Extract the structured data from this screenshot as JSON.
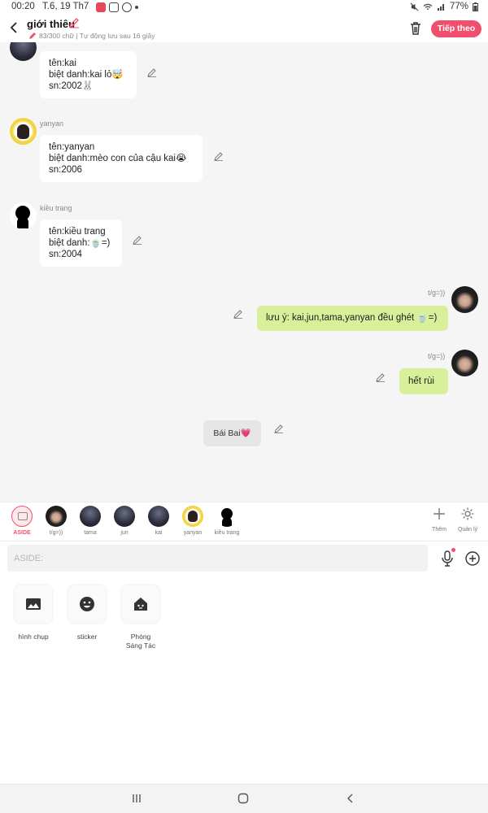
{
  "status_bar": {
    "time": "00:20",
    "date": "T.6, 19 Th7",
    "battery": "77%"
  },
  "header": {
    "title": "giới thiêu",
    "subtitle": "83/300 chữ | Tự động lưu sau 16 giây",
    "follow_button": "Tiếp theo"
  },
  "messages": [
    {
      "side": "left",
      "name": "",
      "avatar": "dark",
      "text": "tên:kai\nbiệt danh:kai lỏ🤯\nsn:2002🐰"
    },
    {
      "side": "left",
      "name": "yanyan",
      "avatar": "yellow",
      "text": "tên:yanyan\nbiệt danh:mèo con của cậu kai😭\nsn:2006"
    },
    {
      "side": "left",
      "name": "kiều trang",
      "avatar": "silhouette",
      "text": "tên:kiều trang\nbiệt danh:🍵=)\nsn:2004"
    },
    {
      "side": "right",
      "name": "t/g=))",
      "avatar": "girl",
      "text": "lưu ý: kai,jun,tama,yanyan đều ghét 🍵=)"
    },
    {
      "side": "right",
      "name": "t/g=))",
      "avatar": "girl",
      "text": "hết rùi"
    },
    {
      "side": "center",
      "name": "",
      "avatar": "",
      "text": "Bái Bai💗"
    }
  ],
  "characters": [
    {
      "label": "ASIDE",
      "avatar": "aside"
    },
    {
      "label": "t/g=))",
      "avatar": "girl"
    },
    {
      "label": "tama",
      "avatar": "dark"
    },
    {
      "label": "jun",
      "avatar": "dark"
    },
    {
      "label": "kai",
      "avatar": "dark"
    },
    {
      "label": "yanyan",
      "avatar": "yellow"
    },
    {
      "label": "kiều trang",
      "avatar": "silhouette"
    }
  ],
  "bar_tools": {
    "add_label": "Thêm",
    "manage_label": "Quản lý"
  },
  "input": {
    "placeholder": "ASIDE:"
  },
  "tools": [
    {
      "label": "hình chụp",
      "icon": "image-icon"
    },
    {
      "label": "sticker",
      "icon": "smiley-icon"
    },
    {
      "label": "Phòng\nSáng Tác",
      "icon": "house-icon"
    }
  ],
  "colors": {
    "accent": "#f0506e",
    "green_bubble": "#d8f09a",
    "chat_bg": "#f5f5f5"
  }
}
